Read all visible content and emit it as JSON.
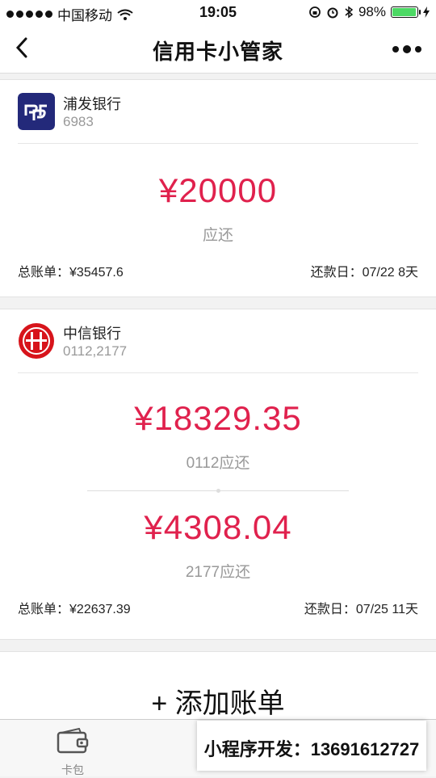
{
  "status_bar": {
    "carrier": "中国移动",
    "time": "19:05",
    "battery": "98%",
    "battery_level": 0.98
  },
  "nav": {
    "title": "信用卡小管家"
  },
  "cards": [
    {
      "bank_name": "浦发银行",
      "card_number": "6983",
      "amounts": [
        {
          "value": "¥20000",
          "label": "应还"
        }
      ],
      "total_label": "总账单：",
      "total_value": "¥35457.6",
      "due_label": "还款日：",
      "due_value": "07/22 8天"
    },
    {
      "bank_name": "中信银行",
      "card_number": "0112,2177",
      "amounts": [
        {
          "value": "¥18329.35",
          "label": "0112应还"
        },
        {
          "value": "¥4308.04",
          "label": "2177应还"
        }
      ],
      "total_label": "总账单：",
      "total_value": "¥22637.39",
      "due_label": "还款日：",
      "due_value": "07/25 11天"
    }
  ],
  "add_bill": {
    "label": "+ 添加账单"
  },
  "tabbar": {
    "tabs": [
      {
        "label": "卡包",
        "icon": "wallet-icon"
      }
    ]
  },
  "overlay": {
    "text": "小程序开发：13691612727"
  },
  "colors": {
    "accent": "#e0214d",
    "spdb_blue": "#23297a",
    "citic_red": "#d7141b"
  }
}
